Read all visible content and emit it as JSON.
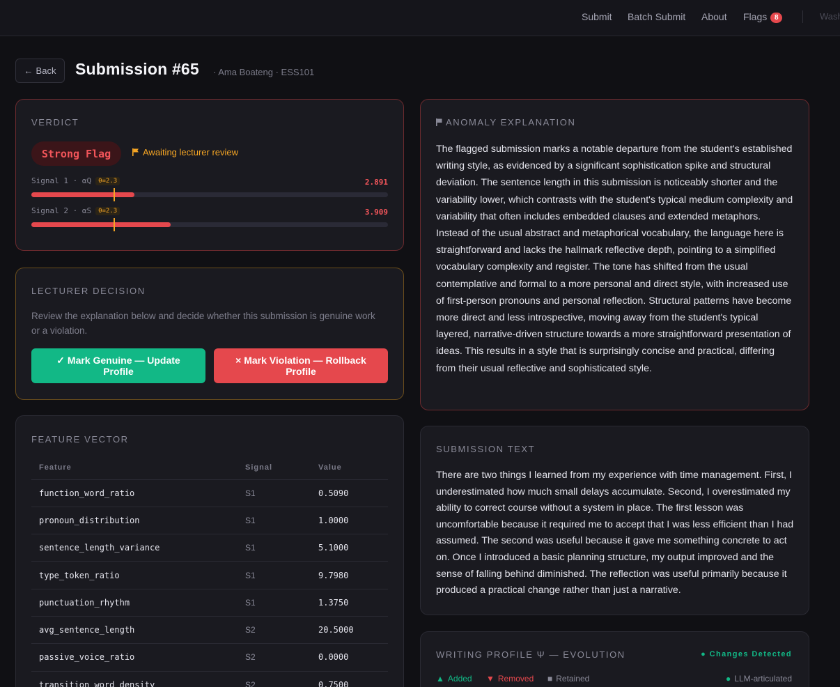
{
  "nav": {
    "items": [
      "Submit",
      "Batch Submit",
      "About",
      "Flags"
    ],
    "flags_count": "8",
    "user": "Wash"
  },
  "header": {
    "back_label": "Back",
    "title": "Submission #65",
    "subtitle": "· Ama Boateng · ESS101"
  },
  "verdict": {
    "heading": "Verdict",
    "badge": "Strong Flag",
    "status": "Awaiting lecturer review",
    "signals": [
      {
        "label": "Signal 1 · αQ",
        "threshold": "θ=2.3",
        "value": "2.891",
        "fill_fraction": 0.29,
        "threshold_fraction": 0.23
      },
      {
        "label": "Signal 2 · αS",
        "threshold": "θ=2.3",
        "value": "3.909",
        "fill_fraction": 0.39,
        "threshold_fraction": 0.23
      }
    ]
  },
  "decision": {
    "heading": "Lecturer Decision",
    "description": "Review the explanation below and decide whether this submission is genuine work or a violation.",
    "genuine_label": "✓ Mark Genuine — Update Profile",
    "violation_label": "× Mark Violation — Rollback Profile"
  },
  "features": {
    "heading": "Feature Vector",
    "columns": [
      "Feature",
      "Signal",
      "Value"
    ],
    "rows": [
      [
        "function_word_ratio",
        "S1",
        "0.5090"
      ],
      [
        "pronoun_distribution",
        "S1",
        "1.0000"
      ],
      [
        "sentence_length_variance",
        "S1",
        "5.1000"
      ],
      [
        "type_token_ratio",
        "S1",
        "9.7980"
      ],
      [
        "punctuation_rhythm",
        "S1",
        "1.3750"
      ],
      [
        "avg_sentence_length",
        "S2",
        "20.5000"
      ],
      [
        "passive_voice_ratio",
        "S2",
        "0.0000"
      ],
      [
        "transition_word_density",
        "S2",
        "0.7500"
      ]
    ]
  },
  "anomaly": {
    "heading": "Anomaly Explanation",
    "text": "The flagged submission marks a notable departure from the student's established writing style, as evidenced by a significant sophistication spike and structural deviation. The sentence length in this submission is noticeably shorter and the variability lower, which contrasts with the student's typical medium complexity and variability that often includes embedded clauses and extended metaphors. Instead of the usual abstract and metaphorical vocabulary, the language here is straightforward and lacks the hallmark reflective depth, pointing to a simplified vocabulary complexity and register. The tone has shifted from the usual contemplative and formal to a more personal and direct style, with increased use of first-person pronouns and personal reflection. Structural patterns have become more direct and less introspective, moving away from the student's typical layered, narrative-driven structure towards a more straightforward presentation of ideas. This results in a style that is surprisingly concise and practical, differing from their usual reflective and sophisticated style."
  },
  "submission": {
    "heading": "Submission Text",
    "text": "There are two things I learned from my experience with time management. First, I underestimated how much small delays accumulate. Second, I overestimated my ability to correct course without a system in place. The first lesson was uncomfortable because it required me to accept that I was less efficient than I had assumed. The second was useful because it gave me something concrete to act on. Once I introduced a basic planning structure, my output improved and the sense of falling behind diminished. The reflection was useful primarily because it produced a practical change rather than just a narrative."
  },
  "profile": {
    "heading": "Writing Profile Ψ — Evolution",
    "status": "● Changes Detected",
    "legend": {
      "added": "Added",
      "removed": "Removed",
      "retained": "Retained",
      "llm": "LLM-articulated"
    },
    "colors": {
      "added": "#12b886",
      "removed": "#e5484d",
      "retained": "#8a8a98"
    }
  }
}
